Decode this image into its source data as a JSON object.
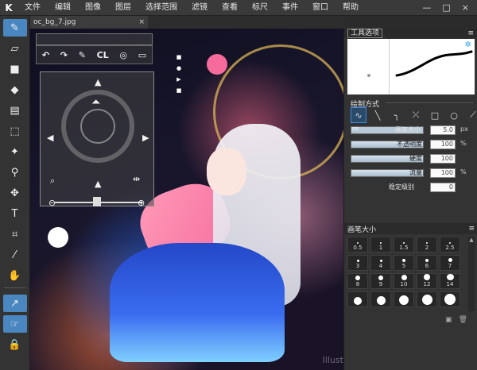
{
  "menubar": {
    "logo": "K",
    "items": [
      "文件",
      "编辑",
      "图像",
      "图层",
      "选择范围",
      "滤镜",
      "查看",
      "标尺",
      "事件",
      "窗口",
      "帮助"
    ],
    "window_controls": [
      "—",
      "□",
      "×"
    ]
  },
  "document": {
    "tab_label": "oc_bg_7.jpg",
    "close_glyph": "×",
    "watermark": "Illust"
  },
  "navigator": {
    "cl_label": "CL"
  },
  "tool_panel": {
    "title": "工具选项",
    "menu_glyph": "≡"
  },
  "draw_mode": {
    "title": "绘制方式",
    "modes": [
      "∿",
      "╲",
      "╮",
      "⤫",
      "□",
      "○",
      "⟋"
    ]
  },
  "properties": [
    {
      "label": "画笔大小",
      "value": "5.0",
      "unit": "px",
      "fill": 0.1
    },
    {
      "label": "不透明度",
      "value": "100",
      "unit": "%",
      "fill": 1.0
    },
    {
      "label": "硬度",
      "value": "100",
      "unit": "",
      "fill": 1.0
    },
    {
      "label": "流量",
      "value": "100",
      "unit": "%",
      "fill": 1.0
    },
    {
      "label": "稳定级别",
      "value": "0",
      "unit": "",
      "fill": 0.0
    }
  ],
  "brush_size": {
    "title": "画笔大小",
    "menu_glyph": "≡",
    "sizes": [
      "0.5",
      "1",
      "1.5",
      "2",
      "2.5",
      "3",
      "4",
      "5",
      "6",
      "7",
      "8",
      "9",
      "10",
      "12",
      "14",
      "",
      "",
      "",
      "",
      ""
    ]
  },
  "colors": {
    "accent": "#4a87c0",
    "panel_bg": "#333333",
    "menubar_bg": "#3a3a3a"
  }
}
